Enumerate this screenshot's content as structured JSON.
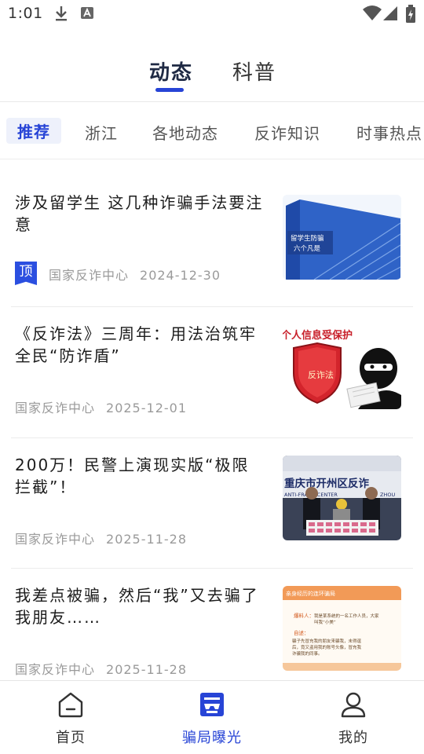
{
  "status_bar": {
    "time": "1:01",
    "icons": [
      "download-icon",
      "app-notification-icon",
      "wifi-icon",
      "signal-icon",
      "battery-icon"
    ]
  },
  "top_tabs": [
    {
      "label": "动态",
      "active": true
    },
    {
      "label": "科普",
      "active": false
    }
  ],
  "categories": [
    {
      "label": "推荐",
      "active": true
    },
    {
      "label": "浙江",
      "active": false
    },
    {
      "label": "各地动态",
      "active": false
    },
    {
      "label": "反诈知识",
      "active": false
    },
    {
      "label": "时事热点",
      "active": false
    }
  ],
  "news": [
    {
      "title": "涉及留学生 这几种诈骗手法要注意",
      "pinned": true,
      "pin_label": "顶",
      "source": "国家反诈中心",
      "date": "2024-12-30",
      "thumb_text": [
        "留学生防骗",
        "六个凡是"
      ]
    },
    {
      "title": "《反诈法》三周年：用法治筑牢全民“防诈盾”",
      "pinned": false,
      "source": "国家反诈中心",
      "date": "2025-12-01",
      "thumb_text": [
        "个人信息受保护",
        "反诈法"
      ]
    },
    {
      "title": "200万！民警上演现实版“极限拦截”！",
      "pinned": false,
      "source": "国家反诈中心",
      "date": "2025-11-28",
      "thumb_text": [
        "重庆市开州区反诈",
        "ANTI-FRAUD CENTER",
        "ZHOU"
      ]
    },
    {
      "title": "我差点被骗，然后“我”又去骗了我朋友……",
      "pinned": false,
      "source": "国家反诈中心",
      "date": "2025-11-28",
      "thumb_text": [
        "亲身经历的连环骗局",
        "爆料人：",
        "我是某系统的一名工作人员，大家",
        "叫我“小美”",
        "自述：",
        "骗子先冒充我的朋友来骗我，未得逞",
        "后，竟又盗用我的账号头像，冒充我",
        "诈骗我的同事。"
      ]
    }
  ],
  "bottom_nav": [
    {
      "label": "首页",
      "icon": "home-icon",
      "active": false
    },
    {
      "label": "骗局曝光",
      "icon": "scam-exposure-icon",
      "active": true
    },
    {
      "label": "我的",
      "icon": "profile-icon",
      "active": false
    }
  ],
  "colors": {
    "accent": "#2744d6",
    "text_primary": "#1c1c1c",
    "text_meta": "#9a9a9a"
  }
}
